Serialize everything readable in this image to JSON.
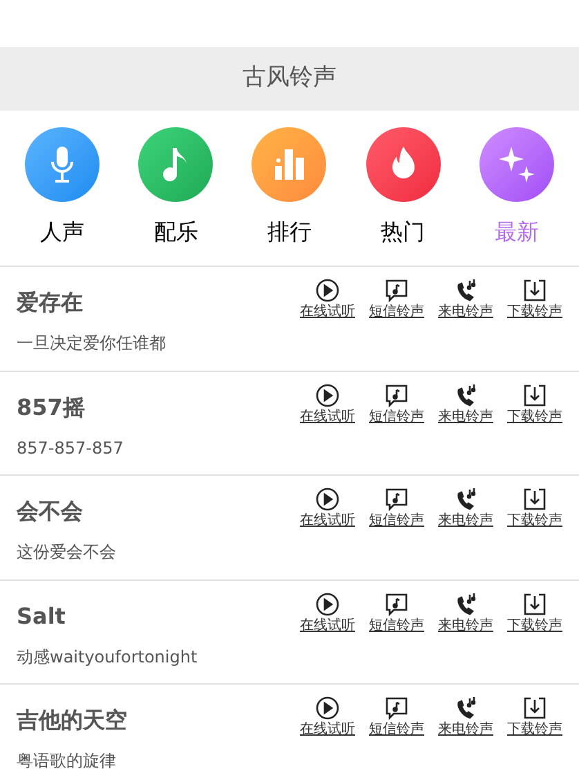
{
  "header": {
    "title": "古风铃声"
  },
  "categories": [
    {
      "kind": "mic",
      "label": "人声",
      "selected": false
    },
    {
      "kind": "note",
      "label": "配乐",
      "selected": false
    },
    {
      "kind": "chart",
      "label": "排行",
      "selected": false
    },
    {
      "kind": "fire",
      "label": "热门",
      "selected": false
    },
    {
      "kind": "sparkle",
      "label": "最新",
      "selected": true
    }
  ],
  "songs": [
    {
      "title": "爱存在",
      "subtitle": "一旦决定爱你任谁都",
      "actions": [
        {
          "kind": "play",
          "label": "在线试听"
        },
        {
          "kind": "sms",
          "label": "短信铃声"
        },
        {
          "kind": "call",
          "label": "来电铃声"
        },
        {
          "kind": "download",
          "label": "下载铃声"
        }
      ]
    },
    {
      "title": "857摇",
      "subtitle": "857-857-857",
      "actions": [
        {
          "kind": "play",
          "label": "在线试听"
        },
        {
          "kind": "sms",
          "label": "短信铃声"
        },
        {
          "kind": "call",
          "label": "来电铃声"
        },
        {
          "kind": "download",
          "label": "下载铃声"
        }
      ]
    },
    {
      "title": "会不会",
      "subtitle": "这份爱会不会",
      "actions": [
        {
          "kind": "play",
          "label": "在线试听"
        },
        {
          "kind": "sms",
          "label": "短信铃声"
        },
        {
          "kind": "call",
          "label": "来电铃声"
        },
        {
          "kind": "download",
          "label": "下载铃声"
        }
      ]
    },
    {
      "title": "Salt",
      "subtitle": "动感waityoufortonight",
      "actions": [
        {
          "kind": "play",
          "label": "在线试听"
        },
        {
          "kind": "sms",
          "label": "短信铃声"
        },
        {
          "kind": "call",
          "label": "来电铃声"
        },
        {
          "kind": "download",
          "label": "下载铃声"
        }
      ]
    },
    {
      "title": "吉他的天空",
      "subtitle": "粤语歌的旋律",
      "actions": [
        {
          "kind": "play",
          "label": "在线试听"
        },
        {
          "kind": "sms",
          "label": "短信铃声"
        },
        {
          "kind": "call",
          "label": "来电铃声"
        },
        {
          "kind": "download",
          "label": "下载铃声"
        }
      ]
    }
  ]
}
